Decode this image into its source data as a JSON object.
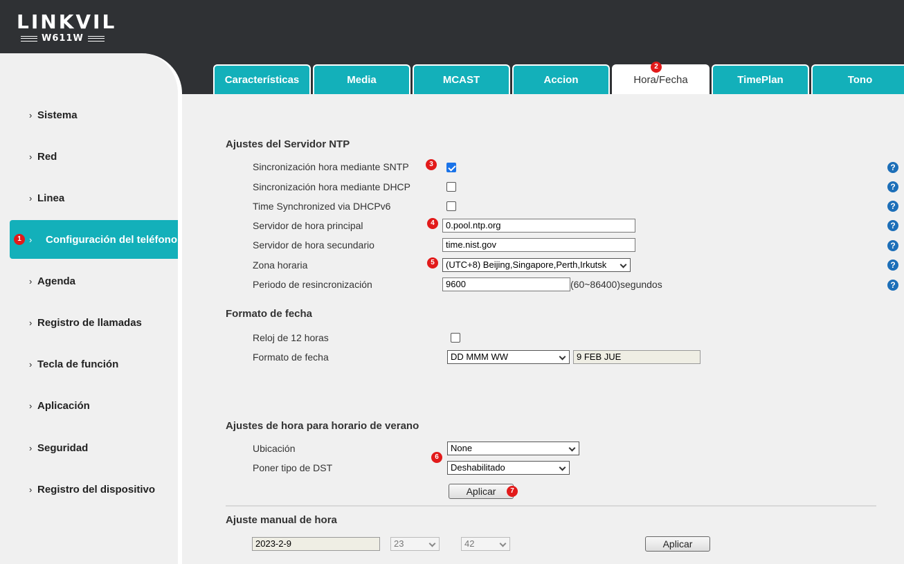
{
  "header": {
    "logo_main": "LINKVIL",
    "logo_model": "W611W"
  },
  "sidebar": {
    "items": [
      {
        "label": "Sistema"
      },
      {
        "label": "Red"
      },
      {
        "label": "Linea"
      },
      {
        "label": "Configuración del teléfono",
        "active": true,
        "badge": "1"
      },
      {
        "label": "Agenda"
      },
      {
        "label": "Registro de llamadas"
      },
      {
        "label": "Tecla de función"
      },
      {
        "label": "Aplicación"
      },
      {
        "label": "Seguridad"
      },
      {
        "label": "Registro del dispositivo"
      }
    ],
    "chevron": "›"
  },
  "tabs": [
    {
      "label": "Características"
    },
    {
      "label": "Media"
    },
    {
      "label": "MCAST"
    },
    {
      "label": "Accion"
    },
    {
      "label": "Hora/Fecha",
      "active": true,
      "badge": "2"
    },
    {
      "label": "TimePlan"
    },
    {
      "label": "Tono"
    }
  ],
  "ntp": {
    "title": "Ajustes del Servidor NTP",
    "sntp_label": "Sincronización hora mediante SNTP",
    "sntp_checked": true,
    "dhcp_label": "Sincronización hora mediante DHCP",
    "dhcp_checked": false,
    "dhcpv6_label": "Time Synchronized via DHCPv6",
    "dhcpv6_checked": false,
    "primary_label": "Servidor de hora principal",
    "primary_value": "0.pool.ntp.org",
    "secondary_label": "Servidor de hora secundario",
    "secondary_value": "time.nist.gov",
    "timezone_label": "Zona horaria",
    "timezone_value": "(UTC+8) Beijing,Singapore,Perth,Irkutsk",
    "resync_label": "Periodo de resincronización",
    "resync_value": "9600",
    "resync_suffix": "(60~86400)segundos"
  },
  "date_format": {
    "title": "Formato de fecha",
    "clock12_label": "Reloj de 12 horas",
    "clock12_checked": false,
    "format_label": "Formato de fecha",
    "format_value": "DD MMM WW",
    "format_preview": "9 FEB JUE"
  },
  "dst": {
    "title": "Ajustes de hora para horario de verano",
    "location_label": "Ubicación",
    "location_value": "None",
    "type_label": "Poner tipo de DST",
    "type_value": "Deshabilitado",
    "apply_label": "Aplicar"
  },
  "manual": {
    "title": "Ajuste manual de hora",
    "date_value": "2023-2-9",
    "hour_value": "23",
    "minute_value": "42",
    "apply_label": "Aplicar"
  },
  "badges": {
    "b1": "1",
    "b2": "2",
    "b3": "3",
    "b4": "4",
    "b5": "5",
    "b6": "6",
    "b7": "7"
  },
  "help_glyph": "?",
  "colors": {
    "accent": "#13b0ba",
    "header": "#2f3134",
    "badge": "#e21a1a",
    "help": "#1d6fb8"
  }
}
